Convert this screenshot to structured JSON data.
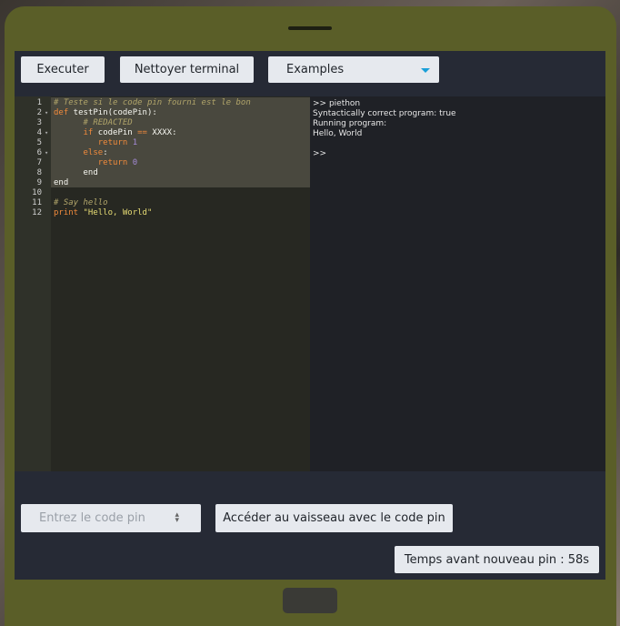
{
  "toolbar": {
    "execute_label": "Executer",
    "clear_terminal_label": "Nettoyer terminal",
    "examples_selected": "Examples"
  },
  "editor": {
    "line_numbers": [
      "1",
      "2",
      "3",
      "4",
      "5",
      "6",
      "7",
      "8",
      "9",
      "10",
      "11",
      "12"
    ],
    "lines": [
      [
        {
          "t": "# Teste si le code pin fourni est le bon",
          "c": "comment"
        }
      ],
      [
        {
          "t": "def",
          "c": "kw"
        },
        {
          "t": " testPin(codePin):",
          "c": "plain"
        }
      ],
      [
        {
          "t": "      # REDACTED",
          "c": "comment"
        }
      ],
      [
        {
          "t": "      if",
          "c": "kw"
        },
        {
          "t": " codePin ",
          "c": "plain"
        },
        {
          "t": "==",
          "c": "kw"
        },
        {
          "t": " XXXX:",
          "c": "plain"
        }
      ],
      [
        {
          "t": "         return",
          "c": "kw"
        },
        {
          "t": " 1",
          "c": "num"
        }
      ],
      [
        {
          "t": "      else",
          "c": "kw"
        },
        {
          "t": ":",
          "c": "plain"
        }
      ],
      [
        {
          "t": "         return",
          "c": "kw"
        },
        {
          "t": " 0",
          "c": "num"
        }
      ],
      [
        {
          "t": "      end",
          "c": "plain"
        }
      ],
      [
        {
          "t": "end",
          "c": "plain"
        }
      ],
      [
        {
          "t": "",
          "c": "plain"
        }
      ],
      [
        {
          "t": "# Say hello",
          "c": "comment"
        }
      ],
      [
        {
          "t": "print",
          "c": "kw"
        },
        {
          "t": " \"Hello, World\"",
          "c": "str"
        }
      ]
    ]
  },
  "terminal": {
    "lines": [
      ">> piethon",
      "Syntactically correct program: true",
      "Running program:",
      "Hello, World",
      "",
      ">>"
    ]
  },
  "pin": {
    "placeholder": "Entrez le code pin",
    "access_label": "Accéder au vaisseau avec le code pin",
    "timer_label": "Temps avant nouveau pin : 58s"
  },
  "colors": {
    "bezel": "#5a5e28",
    "screen_bg": "#262a35",
    "editor_bg": "#272822",
    "terminal_bg": "#1f2126",
    "button_bg": "#e6e9ee",
    "accent": "#1a9fd8"
  }
}
